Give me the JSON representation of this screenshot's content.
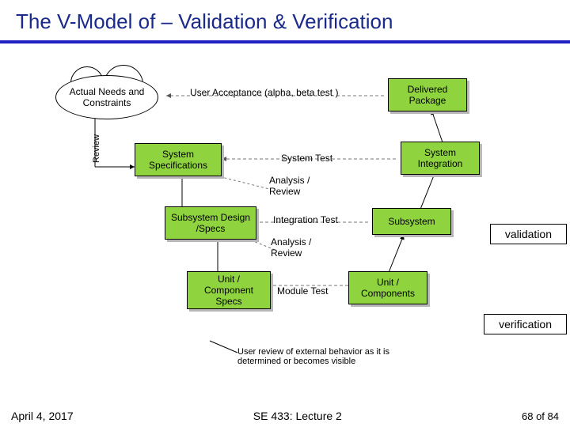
{
  "title": "The V-Model of – Validation & Verification",
  "cloud": "Actual Needs and Constraints",
  "review_label": "Review",
  "level1": {
    "left": "",
    "test": "User Acceptance   (alpha, beta test )",
    "right": "Delivered Package"
  },
  "level2": {
    "left": "System Specifications",
    "test": "System Test",
    "right": "System Integration",
    "ar": "Analysis  /\nReview"
  },
  "level3": {
    "left": "Subsystem Design /Specs",
    "test": "Integration Test",
    "right": "Subsystem",
    "ar": "Analysis  /\nReview"
  },
  "level4": {
    "left": "Unit / Component Specs",
    "test": "Module Test",
    "right": "Unit / Components"
  },
  "tag_validation": "validation",
  "tag_verification": "verification",
  "footnote": "User review of external behavior as it is\ndetermined or becomes visible",
  "footer": {
    "date": "April 4, 2017",
    "course": "SE 433: Lecture 2",
    "page_prefix": "68 of ",
    "page_total": "84"
  }
}
